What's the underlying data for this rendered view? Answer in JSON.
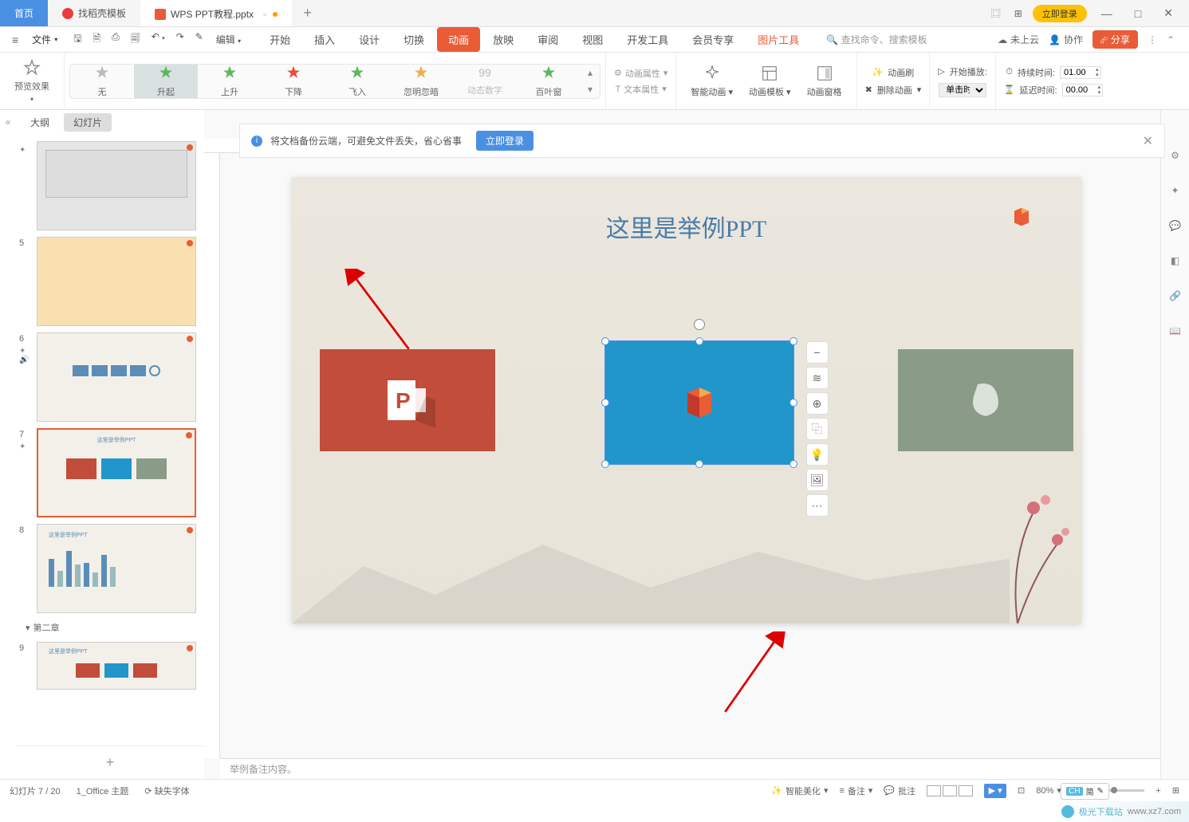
{
  "titleBar": {
    "homeTab": "首页",
    "templateTab": "找稻壳模板",
    "fileTab": "WPS PPT教程.pptx",
    "loginBtn": "立即登录"
  },
  "menuBar": {
    "file": "文件",
    "edit": "编辑",
    "tabs": {
      "start": "开始",
      "insert": "插入",
      "design": "设计",
      "transition": "切换",
      "animation": "动画",
      "slideshow": "放映",
      "review": "审阅",
      "view": "视图",
      "devtools": "开发工具",
      "member": "会员专享",
      "picTools": "图片工具"
    },
    "searchPlaceholder": "查找命令、搜索模板",
    "cloud": "未上云",
    "coop": "协作",
    "share": "分享"
  },
  "ribbon": {
    "preview": "预览效果",
    "anims": {
      "none": "无",
      "rise": "升起",
      "ascend": "上升",
      "descend": "下降",
      "flyin": "飞入",
      "fade": "忽明忽暗",
      "dynamic": "动态数字",
      "blinds": "百叶窗"
    },
    "animProps": "动画属性",
    "textProps": "文本属性",
    "smartAnim": "智能动画",
    "animTemplate": "动画模板",
    "animPane": "动画窗格",
    "animBrush": "动画刷",
    "deleteAnim": "删除动画",
    "startPlay": "开始播放:",
    "startPlayValue": "单击时",
    "duration": "持续时间:",
    "durationValue": "01.00",
    "delay": "延迟时间:",
    "delayValue": "00.00"
  },
  "notification": {
    "text": "将文档备份云端，可避免文件丢失，省心省事",
    "action": "立即登录"
  },
  "slidePanel": {
    "outline": "大纲",
    "slides": "幻灯片",
    "section2": "第二章",
    "nums": [
      "",
      "5",
      "6",
      "7",
      "8",
      "9"
    ]
  },
  "slide": {
    "title": "这里是举例PPT"
  },
  "notes": "举例备注内容。",
  "statusBar": {
    "slideCount": "幻灯片 7 / 20",
    "theme": "1_Office 主题",
    "missingFont": "缺失字体",
    "beautify": "智能美化",
    "remarks": "备注",
    "comments": "批注",
    "zoom": "80%"
  },
  "ime": {
    "ch": "CH",
    "simp": "简"
  },
  "watermark": {
    "site": "极光下载站",
    "url": "www.xz7.com"
  }
}
